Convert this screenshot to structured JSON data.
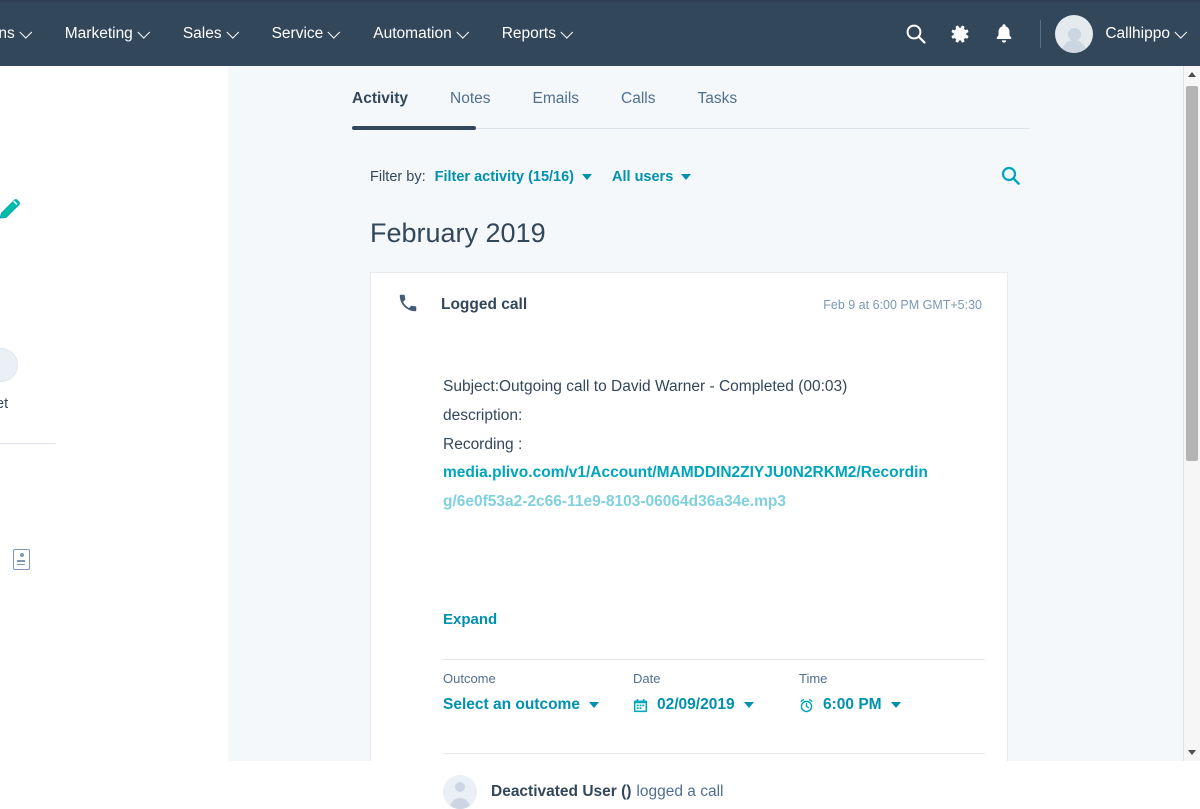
{
  "topnav": {
    "menu": [
      {
        "label": "tions",
        "icon": "chevron-down-icon"
      },
      {
        "label": "Marketing",
        "icon": "chevron-down-icon"
      },
      {
        "label": "Sales",
        "icon": "chevron-down-icon"
      },
      {
        "label": "Service",
        "icon": "chevron-down-icon"
      },
      {
        "label": "Automation",
        "icon": "chevron-down-icon"
      },
      {
        "label": "Reports",
        "icon": "chevron-down-icon"
      }
    ],
    "icons": [
      "search-icon",
      "gear-icon",
      "bell-icon"
    ],
    "username": "Callhippo",
    "avatar": "user-avatar",
    "background_color": "#33475b"
  },
  "left_panel": {
    "pencil_icon": "pencil-edit-icon",
    "partial_avatar": "user-avatar",
    "partial_text": "et",
    "contact_card_icon": "contact-card-icon"
  },
  "tabs": [
    {
      "label": "Activity",
      "active": true
    },
    {
      "label": "Notes",
      "active": false
    },
    {
      "label": "Emails",
      "active": false
    },
    {
      "label": "Calls",
      "active": false
    },
    {
      "label": "Tasks",
      "active": false
    }
  ],
  "filter": {
    "label": "Filter by:",
    "activity_filter": "Filter activity (15/16)",
    "user_filter": "All users",
    "search_icon": "search-icon",
    "link_color": "#0091ae"
  },
  "month_heading": "February 2019",
  "card": {
    "icon": "phone-call-icon",
    "title": "Logged call",
    "timestamp": "Feb 9 at 6:00 PM GMT+5:30",
    "body_lines": [
      "Subject:Outgoing call to David Warner - Completed (00:03)",
      "description:",
      "Recording :"
    ],
    "recording_url_line1": "media.plivo.com/v1/Account/MAMDDIN2ZIYJU0N2RKM2/Recordin",
    "recording_url_line2": "g/6e0f53a2-2c66-11e9-8103-06064d36a34e.mp3",
    "expand_label": "Expand",
    "meta": {
      "outcome": {
        "label": "Outcome",
        "value": "Select an outcome",
        "icon": "chevron-down-icon"
      },
      "date": {
        "label": "Date",
        "value": "02/09/2019",
        "icon": "calendar-icon"
      },
      "time": {
        "label": "Time",
        "value": "6:00 PM",
        "icon": "alarm-clock-icon"
      }
    },
    "footer": {
      "avatar": "user-avatar",
      "user": "Deactivated User ()",
      "action": "logged a call"
    }
  },
  "scrollbar": {
    "up_icon": "scroll-up-arrow-icon",
    "down_icon": "scroll-down-arrow-icon",
    "thumb": "scrollbar-thumb"
  }
}
